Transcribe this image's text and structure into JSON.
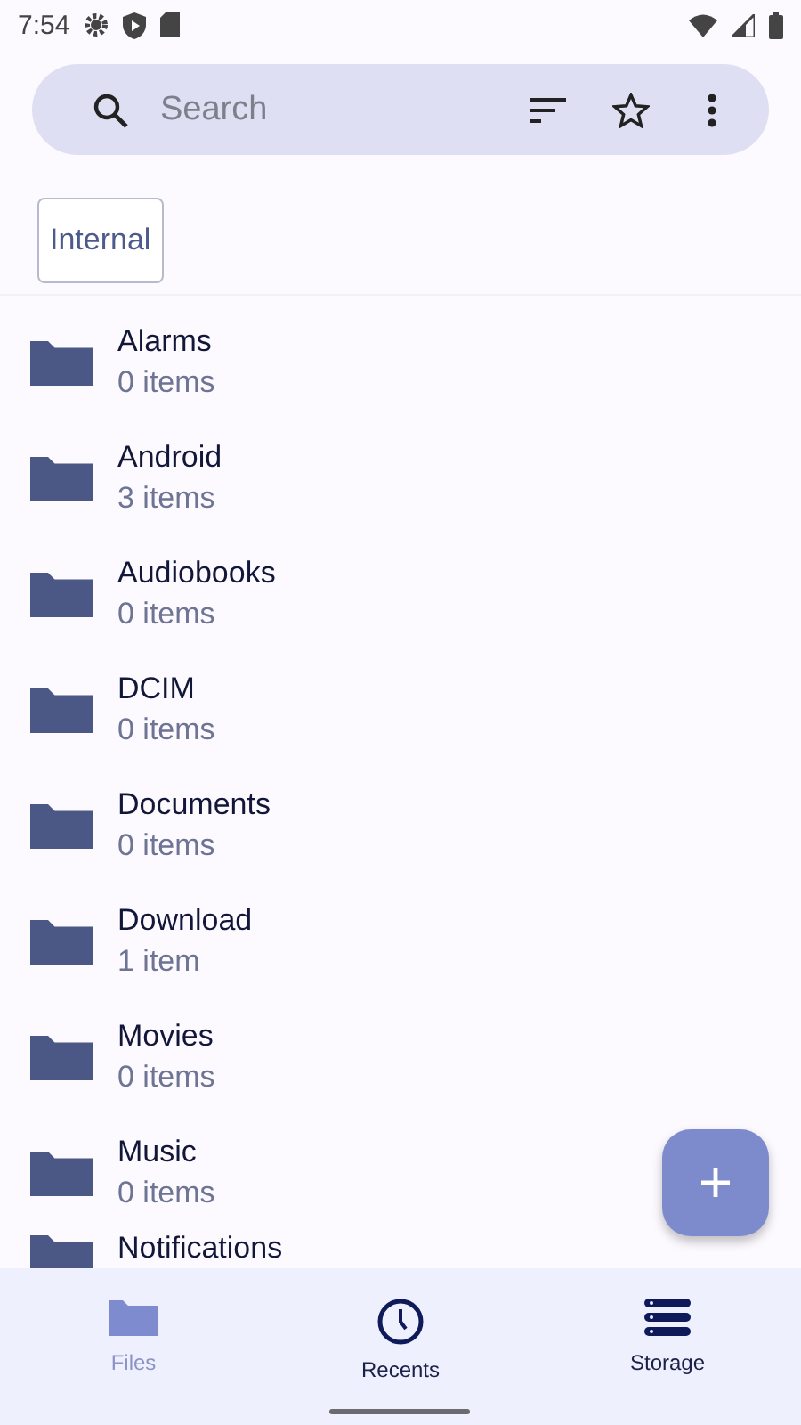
{
  "status_bar": {
    "time": "7:54"
  },
  "search": {
    "placeholder": "Search"
  },
  "storage_chip": {
    "label": "Internal"
  },
  "folders": [
    {
      "name": "Alarms",
      "count": "0 items"
    },
    {
      "name": "Android",
      "count": "3 items"
    },
    {
      "name": "Audiobooks",
      "count": "0 items"
    },
    {
      "name": "DCIM",
      "count": "0 items"
    },
    {
      "name": "Documents",
      "count": "0 items"
    },
    {
      "name": "Download",
      "count": "1 item"
    },
    {
      "name": "Movies",
      "count": "0 items"
    },
    {
      "name": "Music",
      "count": "0 items"
    },
    {
      "name": "Notifications"
    }
  ],
  "nav": [
    {
      "label": "Files",
      "kind": "folder",
      "selected": true
    },
    {
      "label": "Recents",
      "kind": "clock",
      "selected": false
    },
    {
      "label": "Storage",
      "kind": "storage",
      "selected": false
    }
  ]
}
